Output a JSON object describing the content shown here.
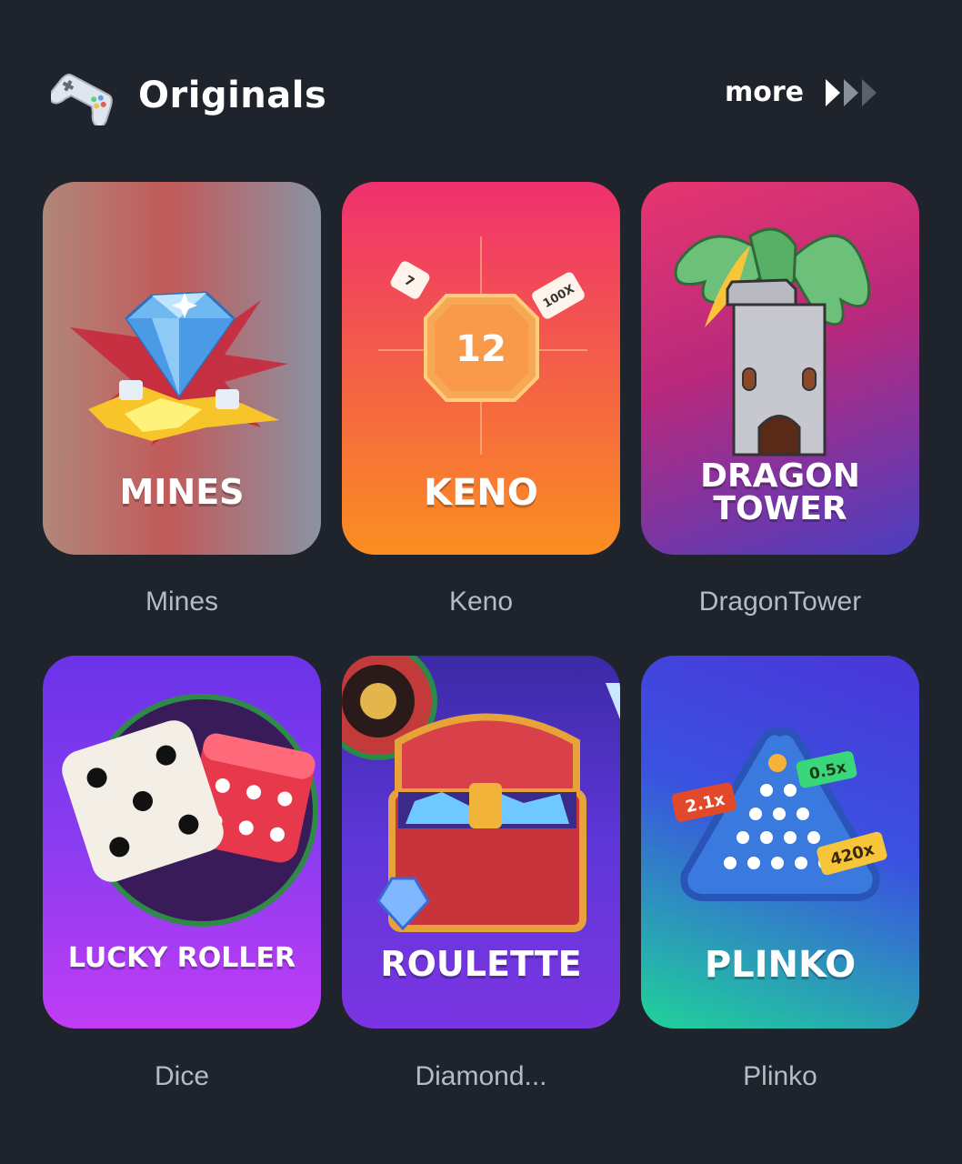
{
  "section": {
    "title": "Originals",
    "icon": "gamepad-icon",
    "more_label": "more",
    "more_icon": "triple-chevron-right-icon"
  },
  "games": [
    {
      "card_title": "MINES",
      "label": "Mines",
      "art": "diamond-explosion"
    },
    {
      "card_title": "KENO",
      "label": "Keno",
      "art": "keno-tile",
      "tile_number": "12",
      "chips": [
        "7",
        "100X"
      ]
    },
    {
      "card_title": "DRAGON\nTOWER",
      "label": "DragonTower",
      "art": "dragon-on-tower"
    },
    {
      "card_title": "LUCKY ROLLER",
      "label": "Dice",
      "art": "dice-pair"
    },
    {
      "card_title": "ROULETTE",
      "label": "Diamond...",
      "art": "treasure-chest-roulette"
    },
    {
      "card_title": "PLINKO",
      "label": "Plinko",
      "art": "plinko-triangle",
      "multipliers": [
        "2.1x",
        "0.5x",
        "420x"
      ]
    }
  ],
  "colors": {
    "background": "#1f232b",
    "label_text": "#b5bac3",
    "title_text": "#ffffff"
  }
}
